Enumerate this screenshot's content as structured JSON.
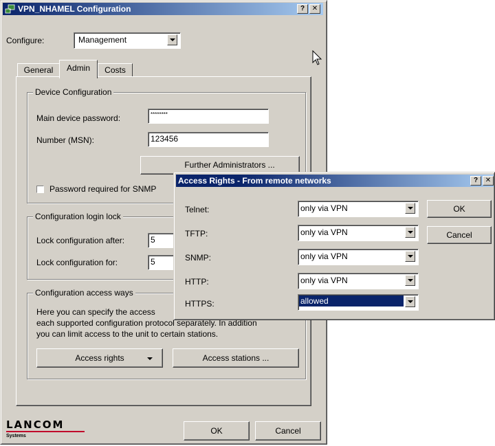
{
  "main_window": {
    "title": "VPN_NHAMEL Configuration",
    "help_btn": "?",
    "close_btn": "✕",
    "configure_label": "Configure:",
    "configure_value": "Management",
    "tabs": [
      {
        "label": "General"
      },
      {
        "label": "Admin"
      },
      {
        "label": "Costs"
      }
    ],
    "device_config": {
      "legend": "Device Configuration",
      "password_label": "Main device password:",
      "password_value": "********",
      "msn_label": "Number (MSN):",
      "msn_value": "123456",
      "further_admins": "Further Administrators ...",
      "snmp_checkbox_label": "Password required for SNMP"
    },
    "login_lock": {
      "legend": "Configuration login lock",
      "lock_after_label": "Lock configuration after:",
      "lock_after_value": "5",
      "lock_for_label": "Lock configuration for:",
      "lock_for_value": "5"
    },
    "access_ways": {
      "legend": "Configuration access ways",
      "description_line1": "Here you can specify the access",
      "description_line2": "each supported configuration protocol separately. In addition",
      "description_line3": "you can limit access to the unit to certain stations.",
      "access_rights_btn": "Access rights",
      "access_stations_btn": "Access stations ..."
    },
    "logo_text": "LANCOM",
    "logo_sub": "Systems",
    "ok": "OK",
    "cancel": "Cancel"
  },
  "dialog": {
    "title": "Access Rights - From remote networks",
    "help_btn": "?",
    "close_btn": "✕",
    "rows": [
      {
        "label": "Telnet:",
        "value": "only via VPN"
      },
      {
        "label": "TFTP:",
        "value": "only via VPN"
      },
      {
        "label": "SNMP:",
        "value": "only via VPN"
      },
      {
        "label": "HTTP:",
        "value": "only via VPN"
      },
      {
        "label": "HTTPS:",
        "value": "allowed"
      }
    ],
    "ok": "OK",
    "cancel": "Cancel"
  },
  "colors": {
    "face": "#d4d0c8",
    "title_start": "#0a246a",
    "title_end": "#a6caf0",
    "selection": "#0a246a",
    "logo_line": "#c0002a"
  },
  "icons": [
    "network-app-icon",
    "mouse-cursor-icon",
    "dropdown-arrow-icon"
  ]
}
